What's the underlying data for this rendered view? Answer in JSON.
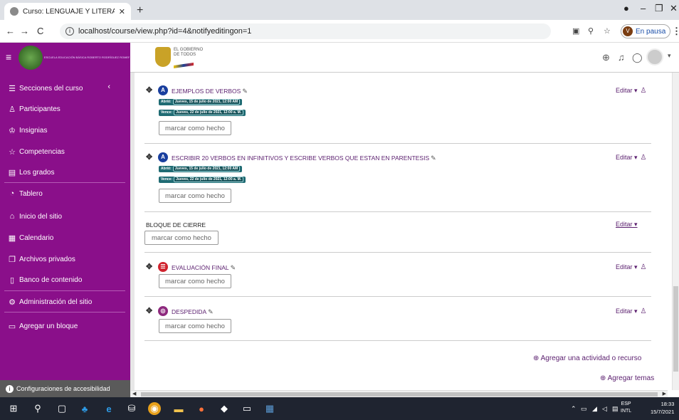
{
  "browser": {
    "tab_title": "Curso: LENGUAJE Y LITERATURA",
    "url": "localhost/course/view.php?id=4&notifyeditingon=1",
    "profile_status": "En pausa",
    "profile_initial": "V"
  },
  "header": {
    "school_name": "ESCUELA EDUCACIÓN BÁSICA ROBERTO RODRÍGUEZ ROMERO",
    "gov_logo_text": "EL GOBIERNO DE TODOS"
  },
  "sidebar": {
    "items": [
      {
        "label": "Secciones del curso",
        "icon": "list-icon"
      },
      {
        "label": "Participantes",
        "icon": "users-icon"
      },
      {
        "label": "Insignias",
        "icon": "badge-icon"
      },
      {
        "label": "Competencias",
        "icon": "star-icon"
      },
      {
        "label": "Los grados",
        "icon": "table-icon"
      },
      {
        "label": "Tablero",
        "icon": "dashboard-icon"
      },
      {
        "label": "Inicio del sitio",
        "icon": "home-icon"
      },
      {
        "label": "Calendario",
        "icon": "calendar-icon"
      },
      {
        "label": "Archivos privados",
        "icon": "files-icon"
      },
      {
        "label": "Banco de contenido",
        "icon": "box-icon"
      },
      {
        "label": "Administración del sitio",
        "icon": "gear-icon"
      },
      {
        "label": "Agregar un bloque",
        "icon": "block-icon"
      }
    ],
    "accessibility": "Configuraciones de accesibilidad"
  },
  "activities": [
    {
      "name": "EJEMPLOS DE VERBOS",
      "icon": "assign-icon",
      "open_label": "Abrió:",
      "open_date": "Jueves, 15 de julio de 2021, 12:00 AM",
      "due_label": "Vence:",
      "due_date": "Jueves, 22 de julio de 2021, 12:00 a. M.",
      "edit": "Editar",
      "complete": "marcar como hecho"
    },
    {
      "name": "ESCRIBIR 20 VERBOS EN INFINITIVOS Y ESCRIBE VERBOS QUE ESTAN EN PARENTESIS",
      "icon": "assign-icon",
      "open_label": "Abrió:",
      "open_date": "Jueves, 15 de julio de 2021, 12:00 AM",
      "due_label": "Vence:",
      "due_date": "Jueves, 22 de julio de 2021, 12:00 a. M.",
      "edit": "Editar",
      "complete": "marcar como hecho"
    },
    {
      "name": "BLOQUE DE CIERRE",
      "edit": "Editar",
      "complete": "marcar como hecho"
    },
    {
      "name": "EVALUACIÓN FINAL",
      "icon": "quiz-icon",
      "edit": "Editar",
      "complete": "marcar como hecho"
    },
    {
      "name": "DESPEDIDA",
      "icon": "chat-icon",
      "edit": "Editar",
      "complete": "marcar como hecho"
    }
  ],
  "actions": {
    "add_activity": "Agregar una actividad o recurso",
    "add_topics": "Agregar temas"
  },
  "taskbar": {
    "lang_top": "ESP",
    "lang_bottom": "INTL",
    "time": "18:33",
    "date": "15/7/2021"
  },
  "colors": {
    "sidebar_bg": "#8a0f8a",
    "link_text": "#5a1e6e",
    "date_badge": "#1f6b73"
  }
}
